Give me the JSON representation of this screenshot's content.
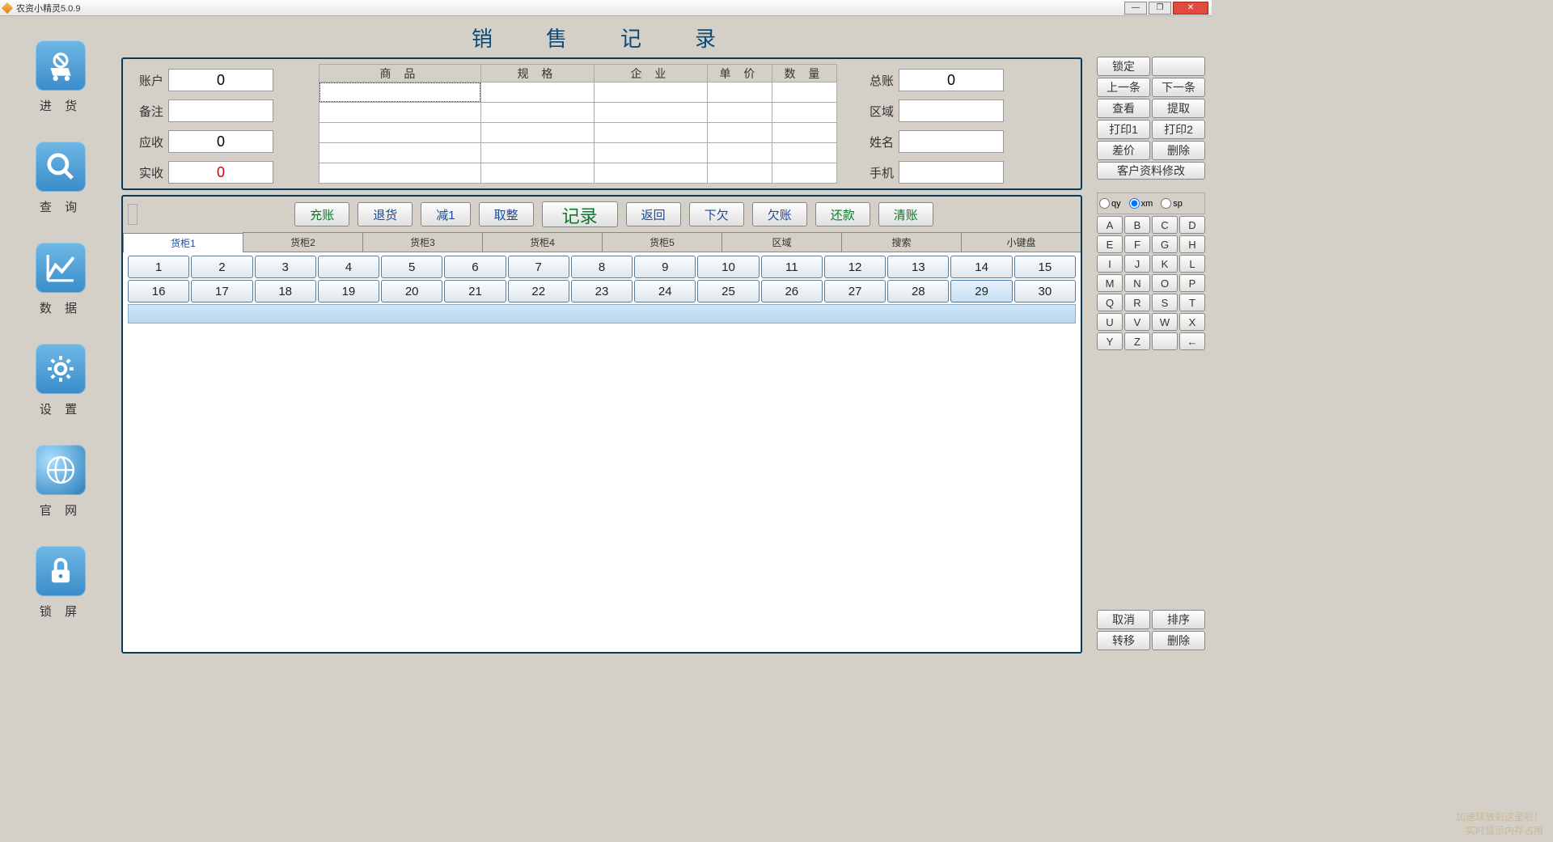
{
  "window": {
    "title": "农资小精灵5.0.9"
  },
  "page_title": "销　售　记　录",
  "nav": [
    {
      "id": "purchase",
      "label": "进 货"
    },
    {
      "id": "query",
      "label": "查 询"
    },
    {
      "id": "data",
      "label": "数 据"
    },
    {
      "id": "settings",
      "label": "设 置"
    },
    {
      "id": "website",
      "label": "官 网"
    },
    {
      "id": "lock",
      "label": "锁 屏"
    }
  ],
  "left_fields": {
    "account_label": "账户",
    "account_value": "0",
    "remark_label": "备注",
    "remark_value": "",
    "receivable_label": "应收",
    "receivable_value": "0",
    "received_label": "实收",
    "received_value": "0"
  },
  "product_headers": [
    "商 品",
    "规 格",
    "企 业",
    "单 价",
    "数 量"
  ],
  "right_fields": {
    "total_label": "总账",
    "total_value": "0",
    "region_label": "区域",
    "region_value": "",
    "name_label": "姓名",
    "name_value": "",
    "phone_label": "手机",
    "phone_value": ""
  },
  "actions": {
    "charge": "充账",
    "return": "退货",
    "minus1": "减1",
    "round": "取整",
    "record": "记录",
    "back": "返回",
    "owe": "下欠",
    "debt": "欠账",
    "repay": "还款",
    "clear": "清账"
  },
  "tabs": [
    "货柜1",
    "货柜2",
    "货柜3",
    "货柜4",
    "货柜5",
    "区域",
    "搜索",
    "小键盘"
  ],
  "numbers": [
    "1",
    "2",
    "3",
    "4",
    "5",
    "6",
    "7",
    "8",
    "9",
    "10",
    "11",
    "12",
    "13",
    "14",
    "15",
    "16",
    "17",
    "18",
    "19",
    "20",
    "21",
    "22",
    "23",
    "24",
    "25",
    "26",
    "27",
    "28",
    "29",
    "30"
  ],
  "rightbar": {
    "lock": "锁定",
    "prev": "上一条",
    "next": "下一条",
    "view": "查看",
    "extract": "提取",
    "print1": "打印1",
    "print2": "打印2",
    "diff": "差价",
    "del": "删除",
    "edit_customer": "客户资料修改",
    "radio_qy": "qy",
    "radio_xm": "xm",
    "radio_sp": "sp",
    "keys": [
      "A",
      "B",
      "C",
      "D",
      "E",
      "F",
      "G",
      "H",
      "I",
      "J",
      "K",
      "L",
      "M",
      "N",
      "O",
      "P",
      "Q",
      "R",
      "S",
      "T",
      "U",
      "V",
      "W",
      "X",
      "Y",
      "Z",
      "",
      "←"
    ],
    "cancel": "取消",
    "sort": "排序",
    "transfer": "转移",
    "del2": "删除"
  },
  "footer": {
    "l1": "加速球放到这里啦！",
    "l2": "实时显示内存占用"
  }
}
